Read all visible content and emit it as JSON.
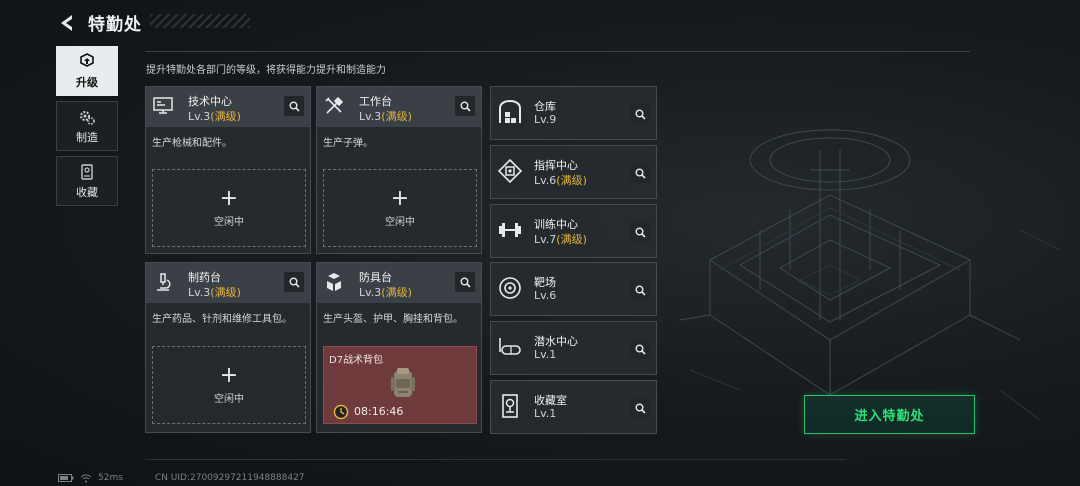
{
  "header": {
    "title": "特勤处"
  },
  "sidebar": {
    "items": [
      {
        "label": "升级",
        "icon": "upgrade-icon",
        "active": true
      },
      {
        "label": "制造",
        "icon": "gears-icon",
        "active": false
      },
      {
        "label": "收藏",
        "icon": "collection-icon",
        "active": false
      }
    ]
  },
  "subtitle": "提升特勤处各部门的等级，将获得能力提升和制造能力",
  "cards": [
    {
      "name": "技术中心",
      "level": "Lv.3",
      "max": "(满级)",
      "desc": "生产枪械和配件。",
      "icon": "computer-icon",
      "slot": {
        "type": "idle",
        "plus": "+",
        "text": "空闲中"
      }
    },
    {
      "name": "工作台",
      "level": "Lv.3",
      "max": "(满级)",
      "desc": "生产子弹。",
      "icon": "tools-icon",
      "slot": {
        "type": "idle",
        "plus": "+",
        "text": "空闲中"
      }
    },
    {
      "name": "制药台",
      "level": "Lv.3",
      "max": "(满级)",
      "desc": "生产药品、针剂和维修工具包。",
      "icon": "microscope-icon",
      "slot": {
        "type": "idle",
        "plus": "+",
        "text": "空闲中"
      }
    },
    {
      "name": "防具台",
      "level": "Lv.3",
      "max": "(满级)",
      "desc": "生产头盔、护甲、胸挂和背包。",
      "icon": "armor-icon",
      "slot": {
        "type": "crafting",
        "item": "D7战术背包",
        "timer": "08:16:46"
      }
    }
  ],
  "rows": [
    {
      "name": "仓库",
      "level": "Lv.9",
      "max": "",
      "icon": "warehouse-icon"
    },
    {
      "name": "指挥中心",
      "level": "Lv.6",
      "max": "(满级)",
      "icon": "chip-icon"
    },
    {
      "name": "训练中心",
      "level": "Lv.7",
      "max": "(满级)",
      "icon": "dumbbell-icon"
    },
    {
      "name": "靶场",
      "level": "Lv.6",
      "max": "",
      "icon": "target-icon"
    },
    {
      "name": "潜水中心",
      "level": "Lv.1",
      "max": "",
      "icon": "diving-mask-icon"
    },
    {
      "name": "收藏室",
      "level": "Lv.1",
      "max": "",
      "icon": "trophy-icon"
    }
  ],
  "enter_button": "进入特勤处",
  "status": {
    "ping": "52ms",
    "uid": "CN UID:27009297211948888427"
  },
  "colors": {
    "accent_green": "#2fe07a",
    "max_level_gold": "#e3b341",
    "crafting_red": "#6f3a3b"
  }
}
